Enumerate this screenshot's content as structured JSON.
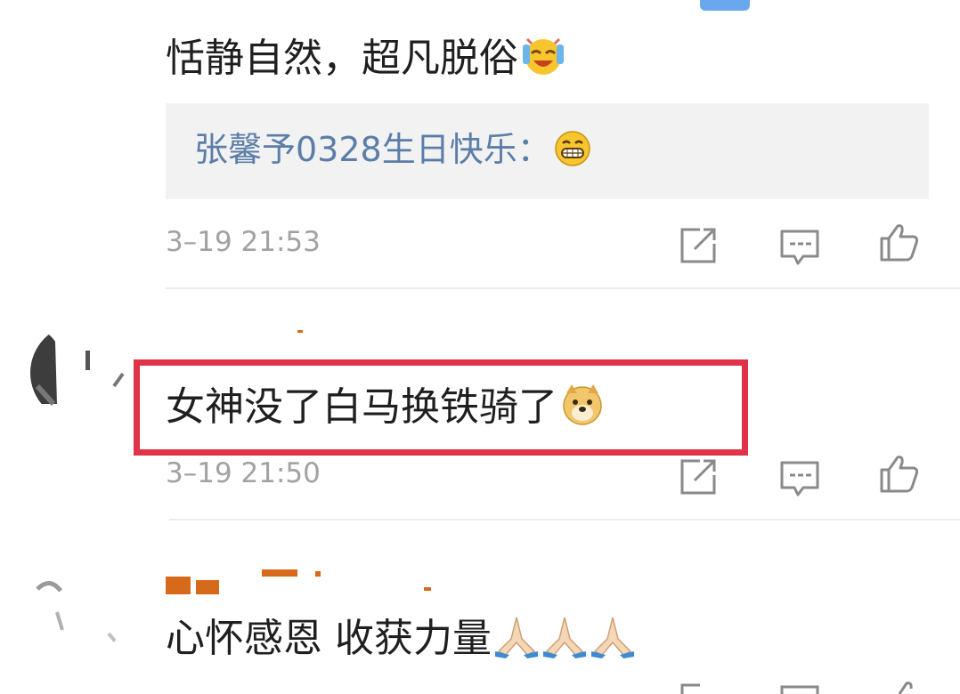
{
  "comments": [
    {
      "text": "恬静自然，超凡脱俗",
      "emoji": "laughing-crying-emoji",
      "reply": {
        "text": "张馨予0328生日快乐：",
        "emoji": "grinning-emoji"
      },
      "timestamp": "3–19 21:53"
    },
    {
      "text": "女神没了白马换铁骑了",
      "emoji": "doge-emoji",
      "highlighted": true,
      "highlight_color": "#e03348",
      "timestamp": "3–19 21:50"
    },
    {
      "text": "心怀感恩 收获力量",
      "emoji": "praying-hands-emoji",
      "emoji_count": 3
    }
  ],
  "icons": [
    "share-icon",
    "comment-icon",
    "like-icon"
  ],
  "colors": {
    "reply_link": "#5b7da8",
    "timestamp": "#a2a2a2",
    "reply_bg": "#f2f2f2",
    "highlight": "#e03348"
  }
}
